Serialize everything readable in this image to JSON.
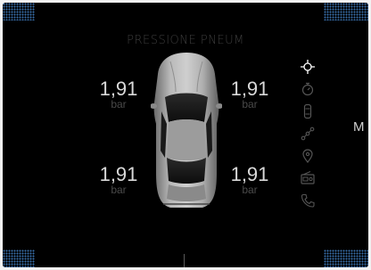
{
  "screen": {
    "title": "PRESSIONE PNEUM",
    "edge_label": "M"
  },
  "tires": {
    "front_left": {
      "value": "1,91",
      "unit": "bar"
    },
    "front_right": {
      "value": "1,91",
      "unit": "bar"
    },
    "rear_left": {
      "value": "1,91",
      "unit": "bar"
    },
    "rear_right": {
      "value": "1,91",
      "unit": "bar"
    }
  },
  "sidebar": {
    "items": [
      {
        "icon": "crosshair-icon",
        "active": true
      },
      {
        "icon": "stopwatch-icon",
        "active": false
      },
      {
        "icon": "car-outline-icon",
        "active": false
      },
      {
        "icon": "route-icon",
        "active": false
      },
      {
        "icon": "location-pin-icon",
        "active": false
      },
      {
        "icon": "radio-icon",
        "active": false
      },
      {
        "icon": "phone-icon",
        "active": false
      }
    ]
  },
  "colors": {
    "background": "#000000",
    "grille": "#3f7dbf",
    "value_text": "#d9d9d9",
    "dim_text": "#3d3d3d",
    "active_icon": "#ffffff",
    "inactive_icon": "#555555"
  }
}
